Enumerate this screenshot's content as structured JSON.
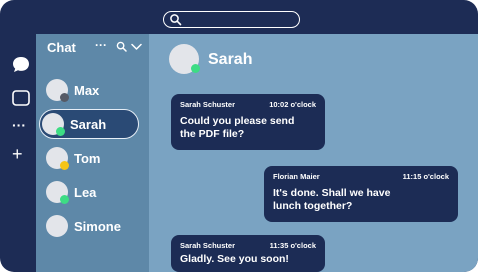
{
  "colors": {
    "frame": "#1d2c55",
    "chat_pane": "#5e88a8",
    "conversation_pane": "#7aa3c2",
    "bubble": "#1c2c55",
    "status_online": "#3ddc84",
    "status_away": "#f5c518",
    "status_offline": "#555a66"
  },
  "top_bar": {
    "search_icon": "search-icon"
  },
  "rail": {
    "items": [
      {
        "icon": "chat-icon"
      },
      {
        "icon": "calendar-icon"
      },
      {
        "icon": "more-icon",
        "glyph": "···"
      },
      {
        "icon": "add-icon",
        "glyph": "+"
      }
    ]
  },
  "chat_list": {
    "title": "Chat",
    "more_glyph": "···",
    "contacts": [
      {
        "name": "Max",
        "status": "offline"
      },
      {
        "name": "Sarah",
        "status": "online",
        "selected": true
      },
      {
        "name": "Tom",
        "status": "away"
      },
      {
        "name": "Lea",
        "status": "online"
      },
      {
        "name": "Simone",
        "status": "none"
      }
    ]
  },
  "conversation": {
    "contact_name": "Sarah",
    "status": "online",
    "messages": [
      {
        "author": "Sarah Schuster",
        "time": "10:02 o'clock",
        "lines": [
          "Could you please send",
          "the PDF file?"
        ]
      },
      {
        "author": "Florian Maier",
        "time": "11:15 o'clock",
        "lines": [
          "It's done. Shall we have",
          "lunch together?"
        ]
      },
      {
        "author": "Sarah Schuster",
        "time": "11:35 o'clock",
        "lines": [
          "Gladly. See you soon!"
        ]
      }
    ]
  }
}
